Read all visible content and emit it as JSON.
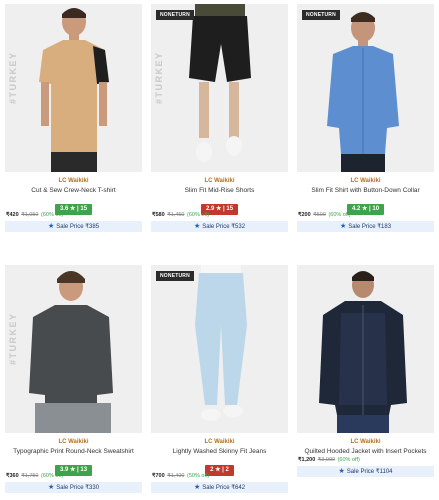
{
  "vertical_text": "#TURKEY",
  "products": [
    {
      "badge": "",
      "watermark": true,
      "brand": "LC Waikiki",
      "title": "Cut & Sew Crew-Neck T-shirt",
      "rating": "3.6 ★ | 15",
      "rating_color": "green",
      "price": "₹420",
      "mrp": "₹1,050",
      "discount": "(60% off)",
      "sale_label": "Sale Price ₹385"
    },
    {
      "badge": "NONETURN",
      "watermark": true,
      "brand": "LC Waikiki",
      "title": "Slim Fit Mid-Rise Shorts",
      "rating": "2.9 ★ | 15",
      "rating_color": "red",
      "price": "₹580",
      "mrp": "₹1,450",
      "discount": "(60% off)",
      "sale_label": "Sale Price ₹532"
    },
    {
      "badge": "NONETURN",
      "watermark": false,
      "brand": "LC Waikiki",
      "title": "Slim Fit Shirt with Button-Down Collar",
      "rating": "4.2 ★ | 10",
      "rating_color": "green",
      "price": "₹200",
      "mrp": "₹500",
      "discount": "(60% off)",
      "sale_label": "Sale Price ₹183"
    },
    {
      "badge": "",
      "watermark": true,
      "brand": "LC Waikiki",
      "title": "Typographic Print Round-Neck Sweatshirt",
      "rating": "3.9 ★ | 13",
      "rating_color": "green",
      "price": "₹360",
      "mrp": "₹1,750",
      "discount": "(60% off)",
      "sale_label": "Sale Price ₹330"
    },
    {
      "badge": "NONETURN",
      "watermark": false,
      "brand": "LC Waikiki",
      "title": "Lightly Washed Skinny Fit Jeans",
      "rating": "2 ★ | 2",
      "rating_color": "red",
      "price": "₹700",
      "mrp": "₹1,400",
      "discount": "(50% off)",
      "sale_label": "Sale Price ₹642"
    },
    {
      "badge": "",
      "watermark": false,
      "brand": "LC Waikiki",
      "title": "Quilted Hooded Jacket with Insert Pockets",
      "rating": "",
      "rating_color": "",
      "price": "₹1,200",
      "mrp": "₹3,000",
      "discount": "(60% off)",
      "sale_label": "Sale Price ₹1104"
    }
  ],
  "colors": {
    "brand": "#b3701f",
    "rating_green": "#3ea34a",
    "rating_red": "#c0392b",
    "sale_bg": "#e8f1fb"
  }
}
